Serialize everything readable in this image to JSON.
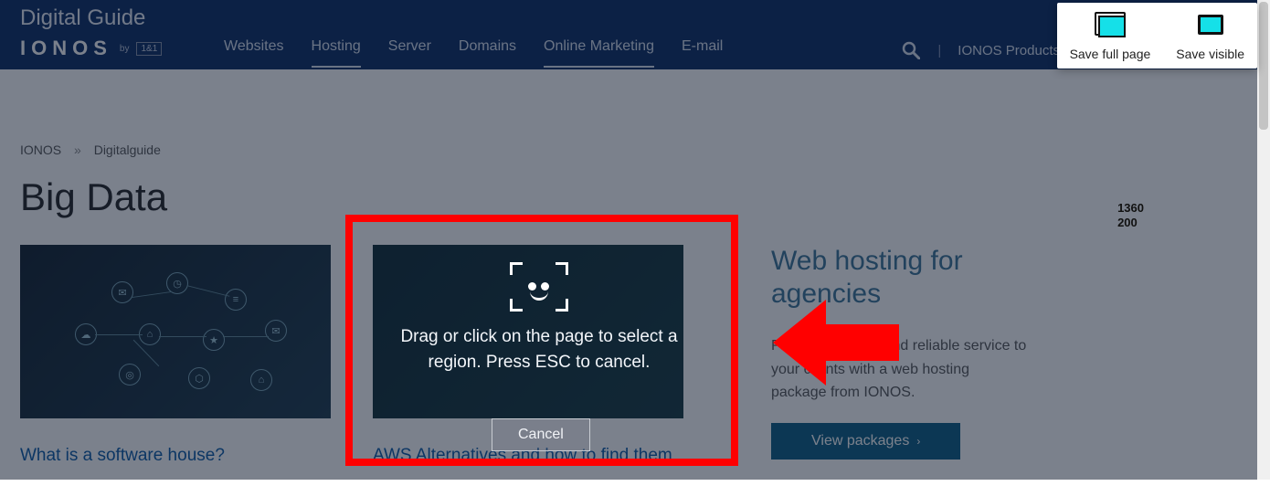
{
  "header": {
    "site_sub": "Digital Guide",
    "brand": "IONOS",
    "brand_by": "by",
    "brand_tag": "1&1",
    "nav": {
      "websites": "Websites",
      "hosting": "Hosting",
      "server": "Server",
      "domains": "Domains",
      "online_marketing": "Online Marketing",
      "email": "E-mail"
    },
    "products_link": "IONOS Products"
  },
  "breadcrumb": {
    "root": "IONOS",
    "sep": "»",
    "current": "Digitalguide"
  },
  "page": {
    "title": "Big Data"
  },
  "cards": {
    "software_house": {
      "title": "What is a software house?"
    },
    "aws": {
      "title": "AWS Alternatives and how to find them"
    }
  },
  "sidebar": {
    "heading": "Web hosting for agencies",
    "body": "Provide powerful and reliable service to your clients with a web hosting package from IONOS.",
    "cta": "View packages",
    "cta_icon": "›"
  },
  "extension": {
    "save_full": "Save full page",
    "save_visible": "Save visible"
  },
  "capture": {
    "message": "Drag or click on the page to select a region. Press ESC to cancel.",
    "cancel": "Cancel"
  },
  "dim_badge": {
    "w": "1360",
    "h": "200"
  }
}
